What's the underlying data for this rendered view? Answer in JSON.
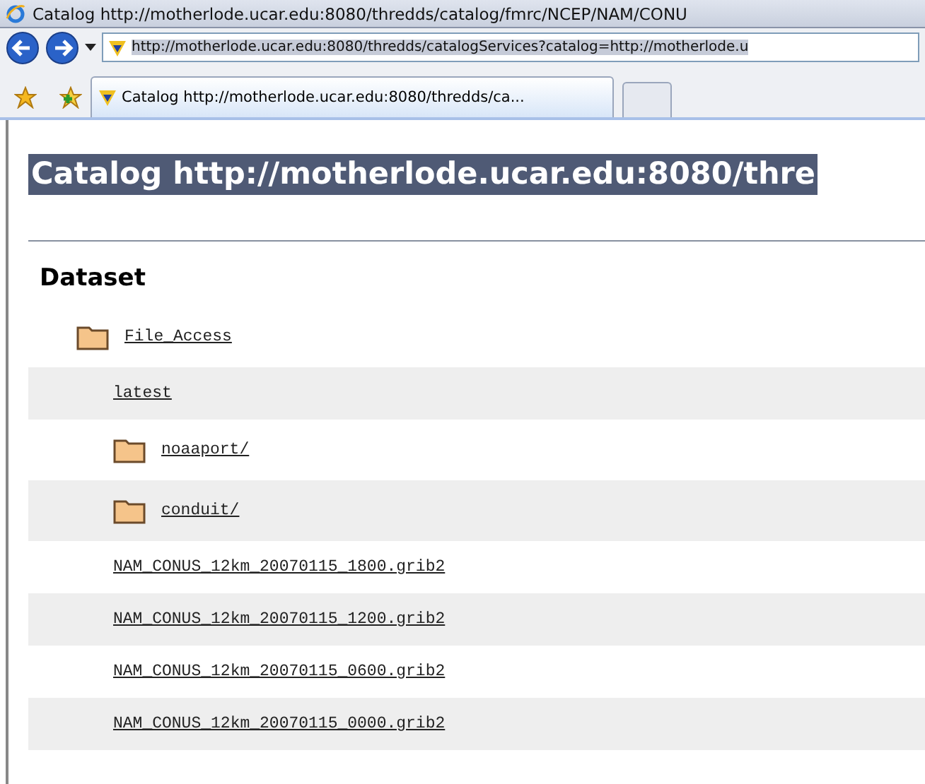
{
  "window": {
    "title": "Catalog http://motherlode.ucar.edu:8080/thredds/catalog/fmrc/NCEP/NAM/CONU"
  },
  "address_bar": {
    "value": "http://motherlode.ucar.edu:8080/thredds/catalogServices?catalog=http://motherlode.u"
  },
  "tabs": [
    {
      "label": "Catalog http://motherlode.ucar.edu:8080/thredds/ca...",
      "selected": true
    }
  ],
  "page": {
    "heading": "Catalog http://motherlode.ucar.edu:8080/thre",
    "section": "Dataset",
    "tree": [
      {
        "kind": "folder",
        "label": "File_Access",
        "children": [
          {
            "kind": "file",
            "label": "latest"
          },
          {
            "kind": "folder",
            "label": "noaaport/"
          },
          {
            "kind": "folder",
            "label": "conduit/"
          },
          {
            "kind": "file",
            "label": "NAM_CONUS_12km_20070115_1800.grib2"
          },
          {
            "kind": "file",
            "label": "NAM_CONUS_12km_20070115_1200.grib2"
          },
          {
            "kind": "file",
            "label": "NAM_CONUS_12km_20070115_0600.grib2"
          },
          {
            "kind": "file",
            "label": "NAM_CONUS_12km_20070115_0000.grib2"
          }
        ]
      }
    ]
  }
}
